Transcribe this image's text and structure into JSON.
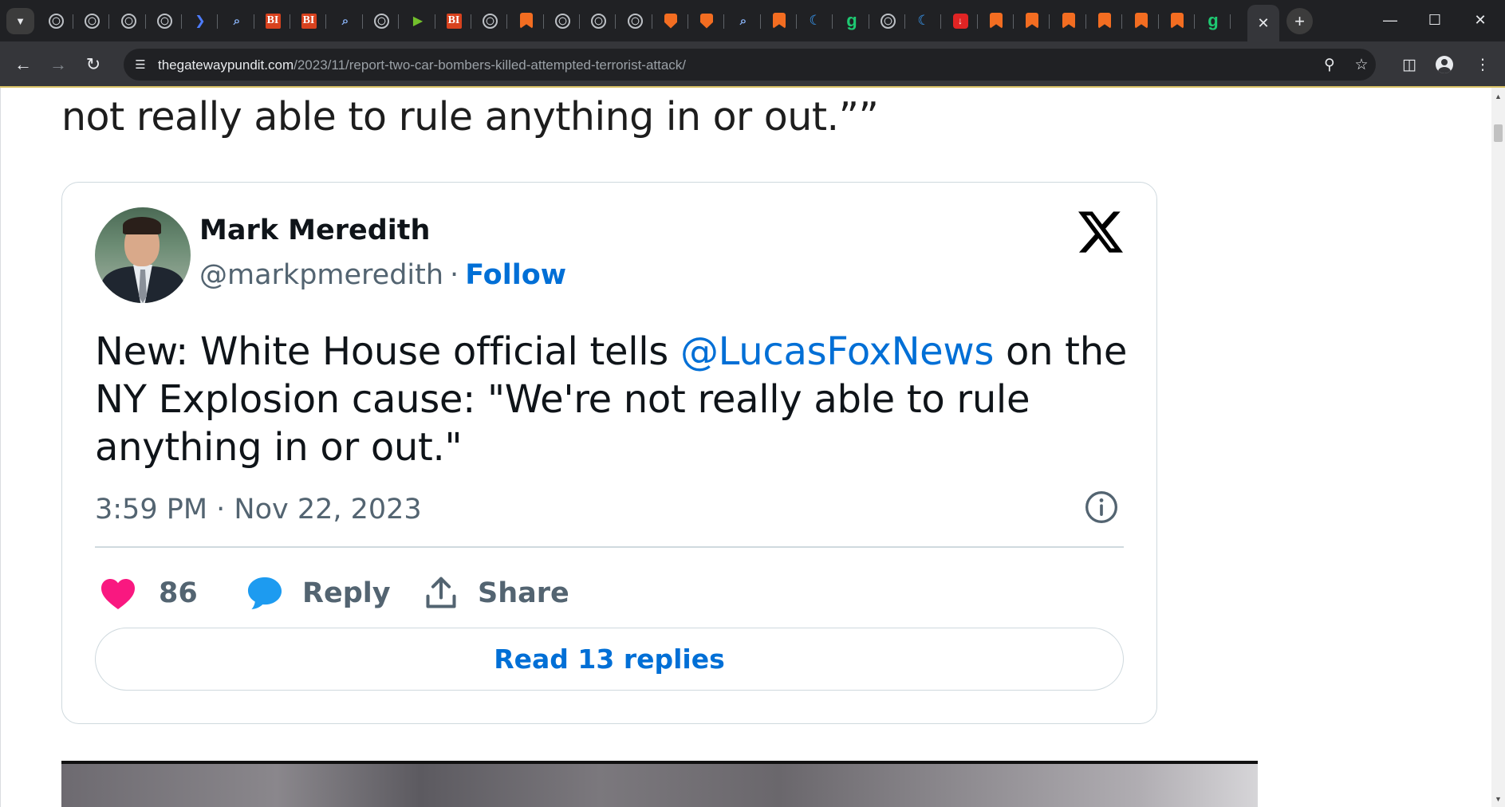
{
  "browser": {
    "url_host": "thegatewaypundit.com",
    "url_path": "/2023/11/report-two-car-bombers-killed-attempted-terrorist-attack/",
    "tabs": [
      {
        "icon": "globe-icon",
        "kind": "globe"
      },
      {
        "icon": "globe-icon",
        "kind": "globe"
      },
      {
        "icon": "globe-icon",
        "kind": "globe"
      },
      {
        "icon": "globe-icon",
        "kind": "globe"
      },
      {
        "icon": "arrow-icon",
        "kind": "arrow"
      },
      {
        "icon": "search-icon",
        "kind": "search"
      },
      {
        "icon": "bi-icon",
        "kind": "bi",
        "text": "BI"
      },
      {
        "icon": "bi-icon",
        "kind": "bi",
        "text": "BI"
      },
      {
        "icon": "search-icon",
        "kind": "search"
      },
      {
        "icon": "globe-icon",
        "kind": "globe"
      },
      {
        "icon": "play-icon",
        "kind": "play"
      },
      {
        "icon": "bi-icon",
        "kind": "bi",
        "text": "BI"
      },
      {
        "icon": "globe-icon",
        "kind": "globe"
      },
      {
        "icon": "bookmark-icon",
        "kind": "bookmark"
      },
      {
        "icon": "globe-icon",
        "kind": "globe"
      },
      {
        "icon": "globe-icon",
        "kind": "globe"
      },
      {
        "icon": "globe-icon",
        "kind": "globe"
      },
      {
        "icon": "shield-icon",
        "kind": "shield"
      },
      {
        "icon": "shield-icon",
        "kind": "shield"
      },
      {
        "icon": "search-icon",
        "kind": "search"
      },
      {
        "icon": "bookmark-icon",
        "kind": "bookmark"
      },
      {
        "icon": "moon-icon",
        "kind": "moon"
      },
      {
        "icon": "g-icon",
        "kind": "g",
        "text": "g"
      },
      {
        "icon": "globe-icon",
        "kind": "globe"
      },
      {
        "icon": "moon-icon",
        "kind": "moon"
      },
      {
        "icon": "red-app-icon",
        "kind": "red"
      },
      {
        "icon": "bookmark-icon",
        "kind": "bookmark"
      },
      {
        "icon": "bookmark-icon",
        "kind": "bookmark"
      },
      {
        "icon": "bookmark-icon",
        "kind": "bookmark"
      },
      {
        "icon": "bookmark-icon",
        "kind": "bookmark"
      },
      {
        "icon": "bookmark-icon",
        "kind": "bookmark"
      },
      {
        "icon": "bookmark-icon",
        "kind": "bookmark"
      },
      {
        "icon": "g-icon",
        "kind": "g",
        "text": "g"
      }
    ],
    "accent_color": "#d9c266"
  },
  "article": {
    "quote_tail": "not really able to rule anything in or out.””"
  },
  "tweet": {
    "author_name": "Mark Meredith",
    "handle": "@markpmeredith",
    "separator": "·",
    "follow_label": "Follow",
    "text_before": "New: White House official tells ",
    "mention": "@LucasFoxNews",
    "text_after": " on the NY Explosion cause: \"We're not really able to rule anything in or out.\"",
    "timestamp": "3:59 PM · Nov 22, 2023",
    "like_count": "86",
    "reply_label": "Reply",
    "share_label": "Share",
    "read_replies_label": "Read 13 replies",
    "colors": {
      "link": "#006fd6",
      "like": "#f91880",
      "reply": "#1d9bf0",
      "muted": "#536471"
    }
  }
}
